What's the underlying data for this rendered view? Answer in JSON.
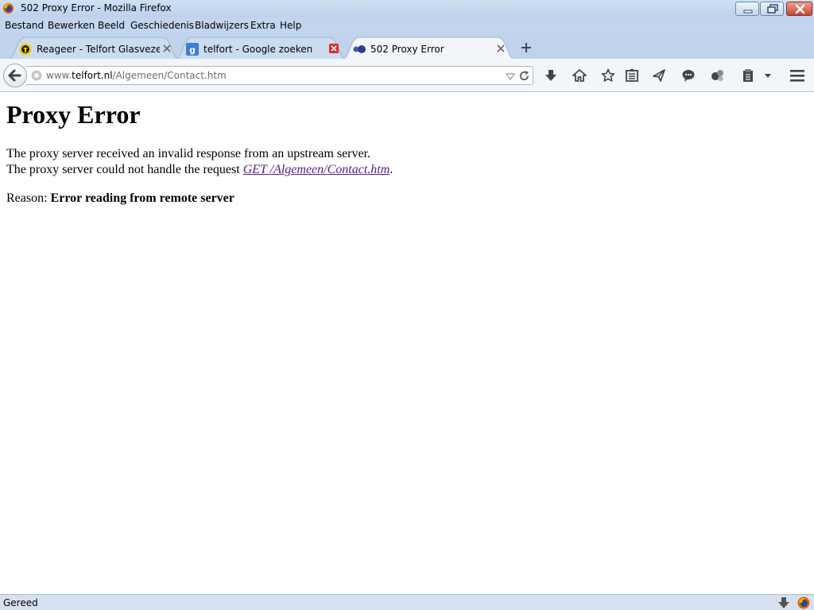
{
  "window": {
    "title": "502 Proxy Error - Mozilla Firefox"
  },
  "menu": [
    {
      "label": "Bestand"
    },
    {
      "label": "Bewerken"
    },
    {
      "label": "Beeld"
    },
    {
      "label": "Geschiedenis"
    },
    {
      "label": "Bladwijzers"
    },
    {
      "label": "Extra"
    },
    {
      "label": "Help"
    }
  ],
  "tabs": [
    {
      "label": "Reageer - Telfort Glasvezel ...",
      "icon": "telfort-favicon",
      "active": false
    },
    {
      "label": "telfort - Google zoeken",
      "icon": "google-favicon",
      "active": false
    },
    {
      "label": "502 Proxy Error",
      "icon": "generic-favicon",
      "active": true
    }
  ],
  "urlbar": {
    "prefix": "www.",
    "host": "telfort.nl",
    "path": "/Algemeen/Contact.htm"
  },
  "toolbar_icons": [
    "download-icon",
    "home-icon",
    "bookmark-star-icon",
    "reading-list-icon",
    "send-icon",
    "chat-icon",
    "addon-icon",
    "clipboard-icon",
    "dropdown-arrow-icon",
    "hamburger-menu-icon"
  ],
  "page": {
    "heading": "Proxy Error",
    "line1": "The proxy server received an invalid response from an upstream server.",
    "line2_prefix": "The proxy server could not handle the request ",
    "line2_link": "GET /Algemeen/Contact.htm",
    "line2_suffix": ".",
    "reason_label": "Reason: ",
    "reason_value": "Error reading from remote server"
  },
  "status": {
    "text": "Gereed"
  },
  "colors": {
    "visited_link": "#551a8b",
    "title_bar": "#c2d5ed",
    "close_button": "#c8452e"
  }
}
